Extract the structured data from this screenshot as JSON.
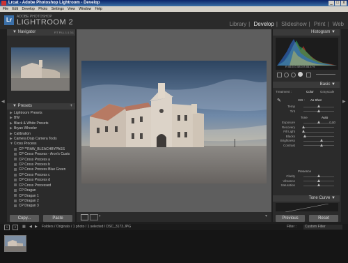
{
  "window": {
    "title": "Lrcat - Adobe Photoshop Lightroom - Develop",
    "controls": [
      "_",
      "□",
      "x"
    ]
  },
  "menubar": [
    "File",
    "Edit",
    "Develop",
    "Photo",
    "Settings",
    "View",
    "Window",
    "Help"
  ],
  "brand": {
    "logo": "Lr",
    "small": "ADOBE PHOTOSHOP",
    "big": "LIGHTROOM 2"
  },
  "modules": [
    "Library",
    "Develop",
    "Slideshow",
    "Print",
    "Web"
  ],
  "navigator": {
    "title": "Navigator",
    "zoom": [
      "FIT",
      "FILL",
      "1:1",
      "3:1"
    ]
  },
  "presets": {
    "title": "Presets",
    "items": [
      {
        "label": "Lightroom Presets",
        "kind": "folder"
      },
      {
        "label": "BW",
        "kind": "folder"
      },
      {
        "label": "Black & White Presets",
        "kind": "folder"
      },
      {
        "label": "Bryan Wheeler",
        "kind": "folder"
      },
      {
        "label": "Calibration",
        "kind": "folder"
      },
      {
        "label": "Camera Dojo Camera Tools",
        "kind": "folder"
      },
      {
        "label": "Cross Process",
        "kind": "open"
      },
      {
        "label": "CP **RAW_BLEACHBYPASS",
        "kind": "item"
      },
      {
        "label": "CP Cross Process - Aron's Custo...",
        "kind": "item"
      },
      {
        "label": "CP Cross Process a",
        "kind": "item"
      },
      {
        "label": "CP Cross Process b",
        "kind": "item"
      },
      {
        "label": "CP Cross Process Blue Green",
        "kind": "item"
      },
      {
        "label": "CP Cross Process c",
        "kind": "item"
      },
      {
        "label": "CP Cross Process d",
        "kind": "item"
      },
      {
        "label": "CP Cross Processed",
        "kind": "item"
      },
      {
        "label": "CP Dragan",
        "kind": "item"
      },
      {
        "label": "CP Dragan 1",
        "kind": "item"
      },
      {
        "label": "CP Dragan 2",
        "kind": "item"
      },
      {
        "label": "CP Dragan 3",
        "kind": "item"
      }
    ]
  },
  "left_buttons": {
    "copy": "Copy...",
    "paste": "Paste"
  },
  "histogram": {
    "title": "Histogram",
    "readout": "R  55.5   G  58.0   B  55.4 %"
  },
  "basic": {
    "title": "Basic",
    "treatment_label": "Treatment :",
    "color": "Color",
    "grayscale": "Grayscale",
    "wb_label": "WB :",
    "wb_value": "As Shot",
    "tone_label": "Tone",
    "auto": "Auto",
    "presence_label": "Presence",
    "sliders_wb": [
      {
        "label": "Temp",
        "value": "",
        "pos": 0.5
      },
      {
        "label": "Tint",
        "value": "",
        "pos": 0.5
      }
    ],
    "sliders_tone": [
      {
        "label": "Exposure",
        "value": "0.00",
        "pos": 0.5
      },
      {
        "label": "Recovery",
        "value": "",
        "pos": 0.0
      },
      {
        "label": "Fill Light",
        "value": "",
        "pos": 0.0
      },
      {
        "label": "Blacks",
        "value": "",
        "pos": 0.05
      },
      {
        "label": "Brightness",
        "value": "",
        "pos": 0.6
      },
      {
        "label": "Contrast",
        "value": "",
        "pos": 0.6
      }
    ],
    "sliders_presence": [
      {
        "label": "Clarity",
        "value": "",
        "pos": 0.5
      },
      {
        "label": "Vibrance",
        "value": "",
        "pos": 0.5
      },
      {
        "label": "Saturation",
        "value": "",
        "pos": 0.5
      }
    ]
  },
  "tone_curve": {
    "title": "Tone Curve"
  },
  "right_buttons": {
    "previous": "Previous",
    "reset": "Reset"
  },
  "filmbar": {
    "pages": [
      "1",
      "2"
    ],
    "path": "Folders / Originals / 1 photo / 1 selected / DSC_3173.JPG",
    "filter_label": "Filter :",
    "filter_value": "Custom Filter"
  }
}
